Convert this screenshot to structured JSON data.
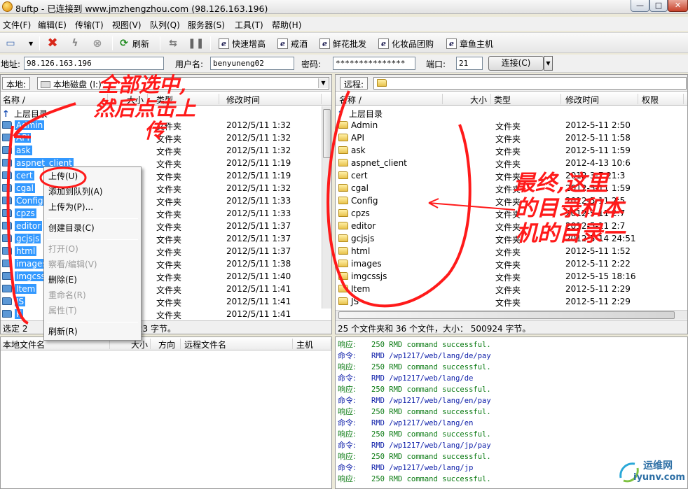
{
  "window": {
    "title": "8uftp - 已连接到 www.jmzhengzhou.com (98.126.163.196)",
    "controls": {
      "minimize": "—",
      "maximize": "□",
      "close": "✕"
    }
  },
  "menu": [
    "文件(F)",
    "编辑(E)",
    "传输(T)",
    "视图(V)",
    "队列(Q)",
    "服务器(S)",
    "工具(T)",
    "帮助(H)"
  ],
  "toolbar": {
    "refresh": "刷新",
    "bookmarks": [
      "快速增高",
      "戒酒",
      "鲜花批发",
      "化妆品团购",
      "章鱼主机"
    ]
  },
  "connection": {
    "address_label": "地址:",
    "address_value": "98.126.163.196",
    "user_label": "用户名:",
    "user_value": "benyuneng02",
    "password_label": "密码:",
    "password_value": "***************",
    "port_label": "端口:",
    "port_value": "21",
    "connect_label": "连接(C)"
  },
  "local": {
    "path_label": "本地:",
    "path_value": "本地磁盘 (I:)",
    "columns": [
      "名称 /",
      "大小",
      "类型",
      "修改时间"
    ],
    "up_label": "上层目录",
    "rows": [
      {
        "name": "Admin",
        "type": "文件夹",
        "date": "2012/5/11 1:32"
      },
      {
        "name": "API",
        "type": "文件夹",
        "date": "2012/5/11 1:32"
      },
      {
        "name": "ask",
        "type": "文件夹",
        "date": "2012/5/11 1:32"
      },
      {
        "name": "aspnet_client",
        "type": "文件夹",
        "date": "2012/5/11 1:19"
      },
      {
        "name": "cert",
        "type": "文件夹",
        "date": "2012/5/11 1:19"
      },
      {
        "name": "cgal",
        "type": "文件夹",
        "date": "2012/5/11 1:32"
      },
      {
        "name": "Config",
        "type": "文件夹",
        "date": "2012/5/11 1:33"
      },
      {
        "name": "cpzs",
        "type": "文件夹",
        "date": "2012/5/11 1:33"
      },
      {
        "name": "editor",
        "type": "文件夹",
        "date": "2012/5/11 1:37"
      },
      {
        "name": "gcjsjs",
        "type": "文件夹",
        "date": "2012/5/11 1:37"
      },
      {
        "name": "html",
        "type": "文件夹",
        "date": "2012/5/11 1:37"
      },
      {
        "name": "images",
        "type": "文件夹",
        "date": "2012/5/11 1:38"
      },
      {
        "name": "imgcssjs",
        "type": "文件夹",
        "date": "2012/5/11 1:40"
      },
      {
        "name": "Item",
        "type": "文件夹",
        "date": "2012/5/11 1:41"
      },
      {
        "name": "JS",
        "type": "文件夹",
        "date": "2012/5/11 1:41"
      },
      {
        "name": "K",
        "type": "文件夹",
        "date": "2012/5/11 1:41"
      }
    ],
    "status": "选定 2",
    "status_tail": "91623 字节。"
  },
  "remote": {
    "path_label": "远程:",
    "columns": [
      "名称 /",
      "大小",
      "类型",
      "修改时间",
      "权限"
    ],
    "up_label": "上层目录",
    "rows": [
      {
        "name": "Admin",
        "type": "文件夹",
        "date": "2012-5-11 2:50"
      },
      {
        "name": "API",
        "type": "文件夹",
        "date": "2012-5-11 1:58"
      },
      {
        "name": "ask",
        "type": "文件夹",
        "date": "2012-5-11 1:59"
      },
      {
        "name": "aspnet_client",
        "type": "文件夹",
        "date": "2012-4-13 10:6"
      },
      {
        "name": "cert",
        "type": "文件夹",
        "date": "2012-3-7 21:3"
      },
      {
        "name": "cgal",
        "type": "文件夹",
        "date": "2012-5-11 1:59"
      },
      {
        "name": "Config",
        "type": "文件夹",
        "date": "2012-5-11 2:5"
      },
      {
        "name": "cpzs",
        "type": "文件夹",
        "date": "2012-5-11 2:7"
      },
      {
        "name": "editor",
        "type": "文件夹",
        "date": "2012-5-11 2:7"
      },
      {
        "name": "gcjsjs",
        "type": "文件夹",
        "date": "2012-5-14 24:51"
      },
      {
        "name": "html",
        "type": "文件夹",
        "date": "2012-5-11 1:52"
      },
      {
        "name": "images",
        "type": "文件夹",
        "date": "2012-5-11 2:22"
      },
      {
        "name": "imgcssjs",
        "type": "文件夹",
        "date": "2012-5-15 18:16"
      },
      {
        "name": "Item",
        "type": "文件夹",
        "date": "2012-5-11 2:29"
      },
      {
        "name": "JS",
        "type": "文件夹",
        "date": "2012-5-11 2:29"
      }
    ],
    "status": "25 个文件夹和 36 个文件，大小： 500924 字节。"
  },
  "queue": {
    "columns": [
      "本地文件名",
      "大小",
      "方向",
      "远程文件名",
      "主机"
    ]
  },
  "log": [
    {
      "kind": "响应:",
      "text": "250 RMD command successful.",
      "t": "resp"
    },
    {
      "kind": "命令:",
      "text": "RMD /wp1217/web/lang/de/pay",
      "t": "cmd"
    },
    {
      "kind": "响应:",
      "text": "250 RMD command successful.",
      "t": "resp"
    },
    {
      "kind": "命令:",
      "text": "RMD /wp1217/web/lang/de",
      "t": "cmd"
    },
    {
      "kind": "响应:",
      "text": "250 RMD command successful.",
      "t": "resp"
    },
    {
      "kind": "命令:",
      "text": "RMD /wp1217/web/lang/en/pay",
      "t": "cmd"
    },
    {
      "kind": "响应:",
      "text": "250 RMD command successful.",
      "t": "resp"
    },
    {
      "kind": "命令:",
      "text": "RMD /wp1217/web/lang/en",
      "t": "cmd"
    },
    {
      "kind": "响应:",
      "text": "250 RMD command successful.",
      "t": "resp"
    },
    {
      "kind": "命令:",
      "text": "RMD /wp1217/web/lang/jp/pay",
      "t": "cmd"
    },
    {
      "kind": "响应:",
      "text": "250 RMD command successful.",
      "t": "resp"
    },
    {
      "kind": "命令:",
      "text": "RMD /wp1217/web/lang/jp",
      "t": "cmd"
    },
    {
      "kind": "响应:",
      "text": "250 RMD command successful.",
      "t": "resp"
    }
  ],
  "context_menu": [
    {
      "label": "上传(U)",
      "disabled": false
    },
    {
      "label": "添加到队列(A)",
      "disabled": false
    },
    {
      "label": "上传为(P)...",
      "disabled": false
    },
    {
      "sep": true
    },
    {
      "label": "创建目录(C)",
      "disabled": false
    },
    {
      "sep": true
    },
    {
      "label": "打开(O)",
      "disabled": true
    },
    {
      "label": "察看/编辑(V)",
      "disabled": true
    },
    {
      "label": "删除(E)",
      "disabled": false
    },
    {
      "label": "重命名(R)",
      "disabled": true
    },
    {
      "label": "属性(T)",
      "disabled": true
    },
    {
      "sep": true
    },
    {
      "label": "刷新(R)",
      "disabled": false
    }
  ],
  "annotations": {
    "left_line1": "全部选中,",
    "left_line2": "然后点击上",
    "left_line3": "传",
    "right_line1": "最终,这里",
    "right_line2": "的目录和本",
    "right_line3": "机的目录一"
  },
  "watermark": {
    "cn": "运维网",
    "url": "iyunv.com"
  },
  "colors": {
    "selection": "#3399ff",
    "annotation": "#ff1a1a",
    "log_response": "#0a7a12",
    "log_command": "#0b1ca8"
  }
}
